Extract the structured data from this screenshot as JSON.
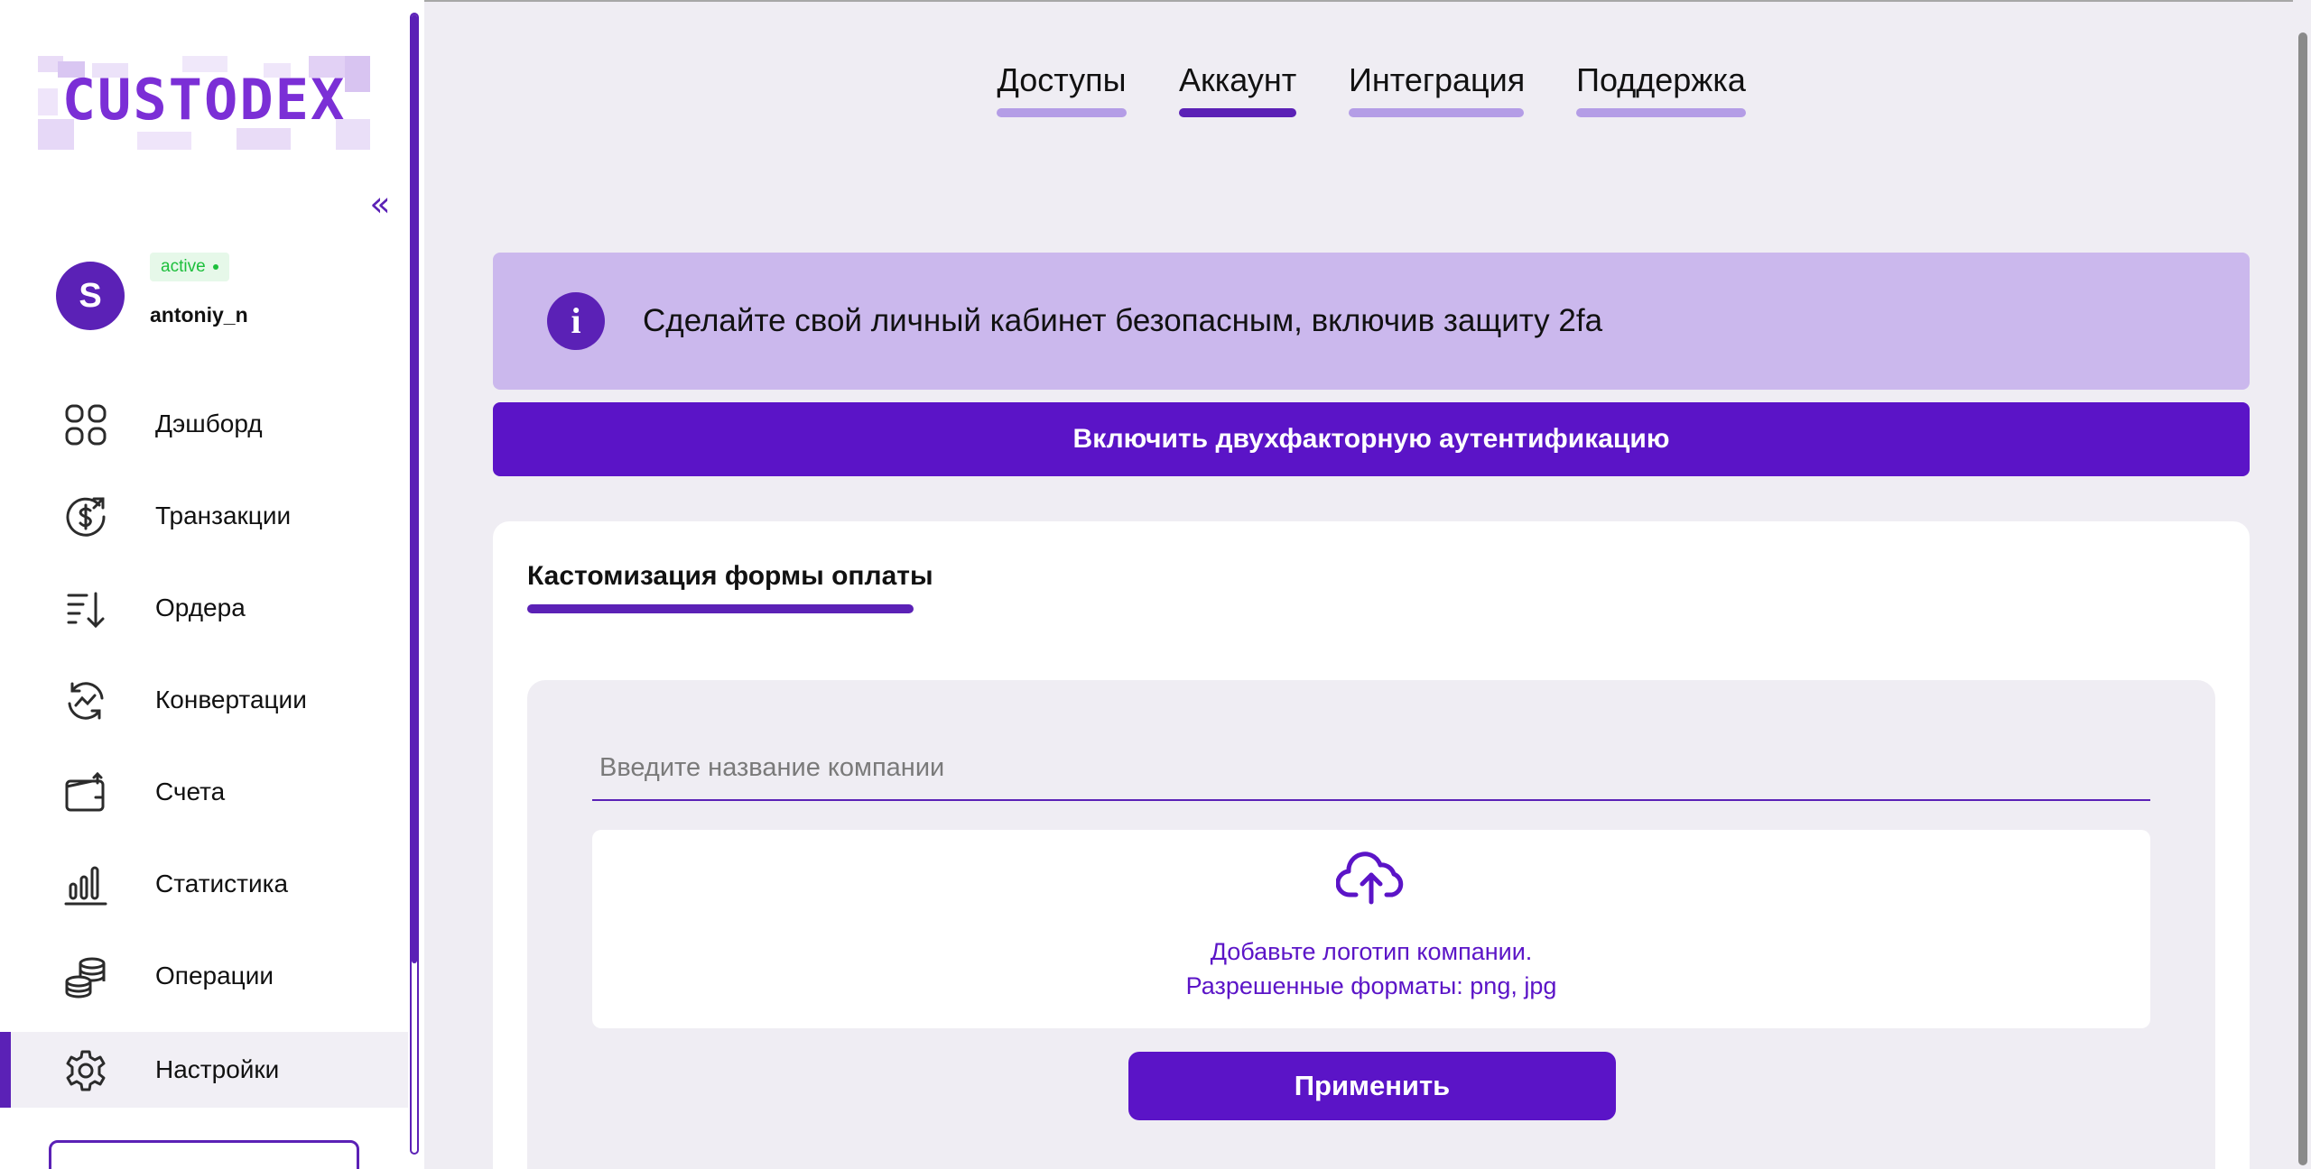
{
  "brand": {
    "logo_text": "CUSTODEX",
    "primary_color": "#5b21b6",
    "button_color": "#5b14c7",
    "alert_bg_color": "#cbb8ed",
    "active_badge_color": "#1dbf3c"
  },
  "sidebar": {
    "collapse_glyph": "«",
    "user": {
      "avatar_initial": "S",
      "status": "active",
      "username": "antoniy_n"
    },
    "items": [
      {
        "label": "Дэшборд",
        "icon": "grid-icon",
        "active": false
      },
      {
        "label": "Транзакции",
        "icon": "dollar-refresh-icon",
        "active": false
      },
      {
        "label": "Ордера",
        "icon": "sort-list-icon",
        "active": false
      },
      {
        "label": "Конвертации",
        "icon": "exchange-icon",
        "active": false
      },
      {
        "label": "Счета",
        "icon": "wallet-icon",
        "active": false
      },
      {
        "label": "Статистика",
        "icon": "bar-chart-icon",
        "active": false
      },
      {
        "label": "Операции",
        "icon": "coins-icon",
        "active": false
      },
      {
        "label": "Настройки",
        "icon": "gear-icon",
        "active": true
      }
    ]
  },
  "tabs": [
    {
      "label": "Доступы",
      "active": false
    },
    {
      "label": "Аккаунт",
      "active": true
    },
    {
      "label": "Интеграция",
      "active": false
    },
    {
      "label": "Поддержка",
      "active": false
    }
  ],
  "alert": {
    "icon": "info-icon",
    "icon_glyph": "i",
    "text": "Сделайте свой личный кабинет безопасным, включив защиту 2fa"
  },
  "enable_2fa_button": "Включить двухфакторную аутентификацию",
  "customization": {
    "title": "Кастомизация формы оплаты",
    "company_input_placeholder": "Введите название компании",
    "company_input_value": "",
    "upload_line1": "Добавьте логотип компании.",
    "upload_line2": "Разрешенные форматы: png, jpg",
    "apply_button": "Применить"
  }
}
